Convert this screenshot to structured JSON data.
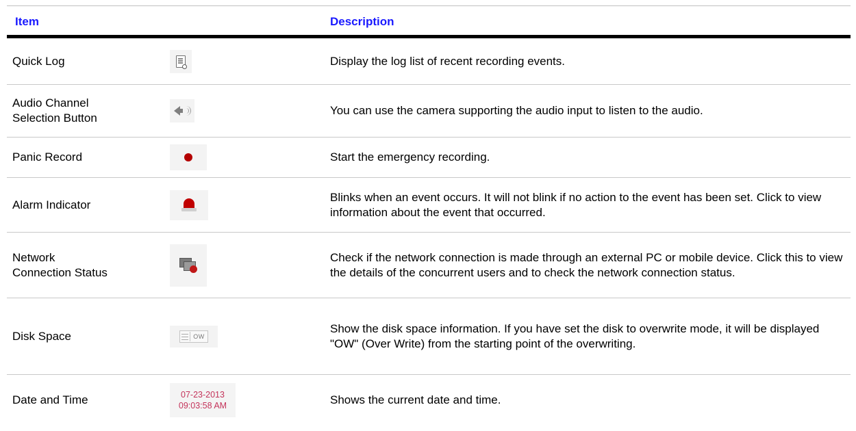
{
  "header": {
    "item": "Item",
    "description": "Description"
  },
  "rows": [
    {
      "name": "Quick Log",
      "icon": "quick-log-icon",
      "description": "Display the log list of recent recording events."
    },
    {
      "name": "Audio Channel\nSelection Button",
      "icon": "speaker-icon",
      "description": "You can use the camera supporting the audio input to listen to the audio."
    },
    {
      "name": "Panic Record",
      "icon": "record-dot-icon",
      "description": "Start the emergency recording."
    },
    {
      "name": "Alarm Indicator",
      "icon": "alarm-light-icon",
      "description": "Blinks when an event occurs. It will not blink if no action to the event has been set. Click to view information about the event that occurred."
    },
    {
      "name": "Network\nConnection Status",
      "icon": "network-monitors-icon",
      "description": "Check if the network connection is made through an external PC or mobile device. Click this to view the details of the concurrent users and to check the network connection status."
    },
    {
      "name": "Disk Space",
      "icon": "disk-space-icon",
      "icon_text": "OW",
      "description": "Show the disk space information. If you have set the disk to overwrite mode, it will be displayed \"OW\" (Over Write) from the starting point of the overwriting."
    },
    {
      "name": "Date and Time",
      "icon": "date-time-display",
      "icon_date": "07-23-2013",
      "icon_time": "09:03:58 AM",
      "description": "Shows the current date and time."
    }
  ],
  "colors": {
    "header_text": "#1a1aff",
    "panic_dot": "#b40000",
    "alarm": "#c00000",
    "datetime_text": "#c4335a"
  }
}
